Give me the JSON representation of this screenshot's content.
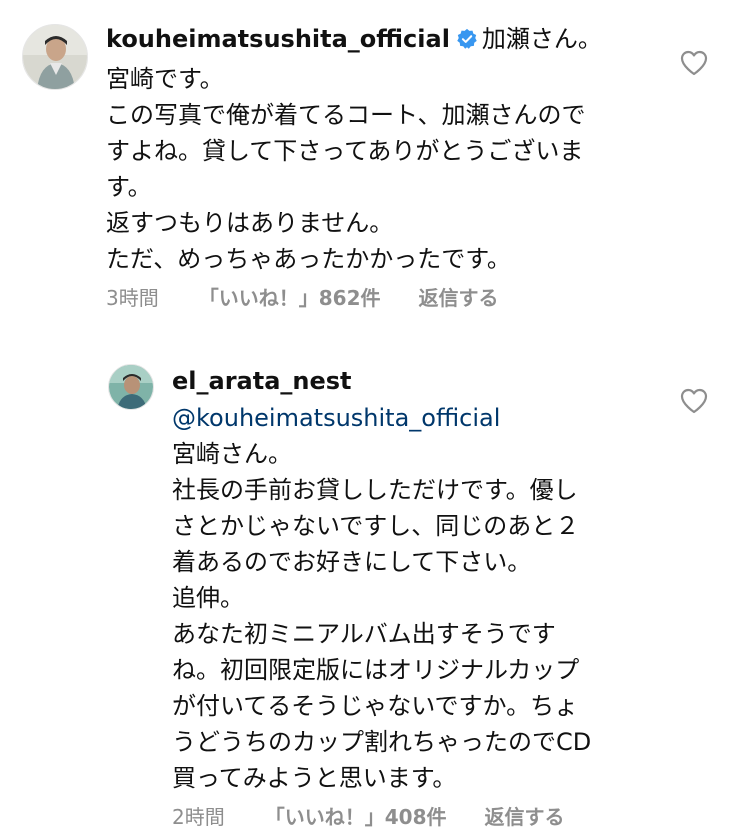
{
  "comments": [
    {
      "username": "kouheimatsushita_official",
      "verified": true,
      "header_text": "加瀬さん。",
      "lines": [
        "宮崎です。",
        "この写真で俺が着てるコート、加瀬さんので",
        "すよね。貸して下さってありがとうございま",
        "す。",
        "返すつもりはありません。",
        "ただ、めっちゃあったかかったです。"
      ],
      "time": "3時間",
      "likes": "「いいね！」862件",
      "reply": "返信する",
      "avatar_icon": "avatar-photo",
      "like_icon": "heart-outline-icon"
    },
    {
      "username": "el_arata_nest",
      "verified": false,
      "mention": "@kouheimatsushita_official",
      "lines": [
        "宮崎さん。",
        "社長の手前お貸ししただけです。優し",
        "さとかじゃないですし、同じのあと２",
        "着あるのでお好きにして下さい。",
        "追伸。",
        "あなた初ミニアルバム出すそうです",
        "ね。初回限定版にはオリジナルカップ",
        "が付いてるそうじゃないですか。ちょ",
        "うどうちのカップ割れちゃったのでCD",
        "買ってみようと思います。"
      ],
      "time": "2時間",
      "likes": "「いいね！」408件",
      "reply": "返信する",
      "avatar_icon": "avatar-photo",
      "like_icon": "heart-outline-icon"
    }
  ],
  "colors": {
    "text": "#111111",
    "meta": "#8e8e8e",
    "mention": "#00376b",
    "verified": "#3897f0"
  }
}
